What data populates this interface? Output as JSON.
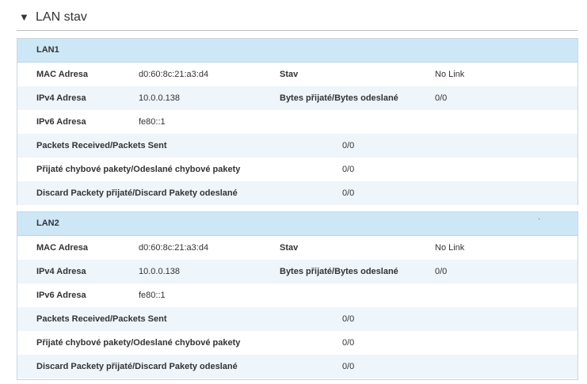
{
  "section": {
    "title": "LAN stav",
    "toggle": "▼"
  },
  "lan1": {
    "title": "LAN1",
    "mac_label": "MAC Adresa",
    "mac": "d0:60:8c:21:a3:d4",
    "stav_label": "Stav",
    "stav": "No Link",
    "ipv4_label": "IPv4 Adresa",
    "ipv4": "10.0.0.138",
    "bytes_label": "Bytes přijaté/Bytes odeslané",
    "bytes": "0/0",
    "ipv6_label": "IPv6 Adresa",
    "ipv6": "fe80::1",
    "packets_label": "Packets Received/Packets Sent",
    "packets": "0/0",
    "errors_label": "Přijaté chybové pakety/Odeslané chybové pakety",
    "errors": "0/0",
    "discard_label": "Discard Packety přijaté/Discard Pakety odeslané",
    "discard": "0/0"
  },
  "lan2": {
    "title": "LAN2",
    "mac_label": "MAC Adresa",
    "mac": "d0:60:8c:21:a3:d4",
    "stav_label": "Stav",
    "stav": "No Link",
    "ipv4_label": "IPv4 Adresa",
    "ipv4": "10.0.0.138",
    "bytes_label": "Bytes přijaté/Bytes odeslané",
    "bytes": "0/0",
    "ipv6_label": "IPv6 Adresa",
    "ipv6": "fe80::1",
    "packets_label": "Packets Received/Packets Sent",
    "packets": "0/0",
    "errors_label": "Přijaté chybové pakety/Odeslané chybové pakety",
    "errors": "0/0",
    "discard_label": "Discard Packety přijaté/Discard Pakety odeslané",
    "discard": "0/0"
  }
}
